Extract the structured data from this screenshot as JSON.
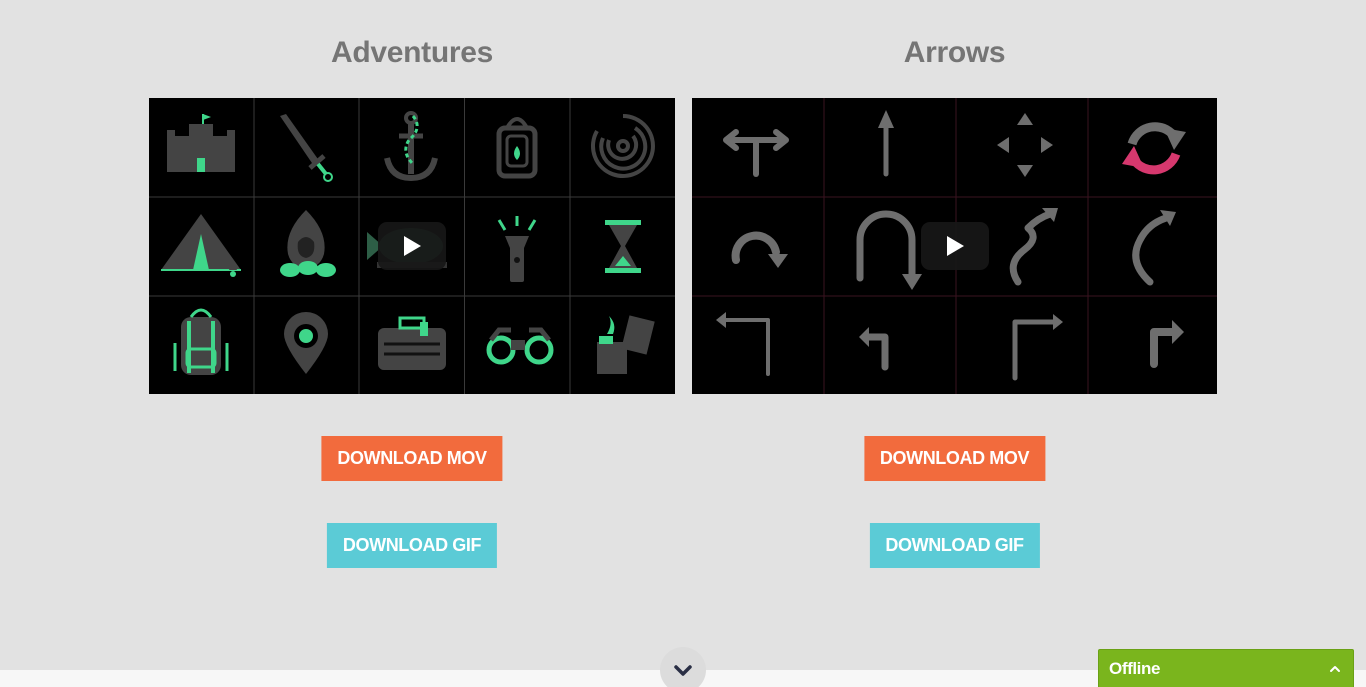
{
  "colors": {
    "background": "#e2e2e2",
    "mov_button": "#f26b3d",
    "gif_button": "#5bcbd6",
    "chat_bar": "#7ab51d",
    "icon_gray": "#444444",
    "icon_green": "#3fd68a",
    "arrow_gray": "#6e6e6e",
    "arrow_pink": "#d6386e"
  },
  "sections": [
    {
      "title": "Adventures",
      "icons": [
        "castle-icon",
        "sword-icon",
        "anchor-icon",
        "lantern-icon",
        "maze-icon",
        "tent-icon",
        "campfire-icon",
        "fish-icon",
        "flashlight-icon",
        "hourglass-icon",
        "backpack-icon",
        "map-pin-icon",
        "suitcase-icon",
        "binoculars-icon",
        "lighter-icon"
      ],
      "mov_label": "DOWNLOAD MOV",
      "gif_label": "DOWNLOAD GIF"
    },
    {
      "title": "Arrows",
      "icons": [
        "split-arrow-icon",
        "up-arrow-icon",
        "four-way-arrows-icon",
        "refresh-arrows-icon",
        "curved-right-arrow-icon",
        "u-turn-arrow-icon",
        "s-curve-arrow-icon",
        "curved-up-arrow-icon",
        "corner-left-arrow-icon",
        "turn-left-arrow-icon",
        "corner-right-arrow-icon",
        "turn-right-arrow-icon"
      ],
      "mov_label": "DOWNLOAD MOV",
      "gif_label": "DOWNLOAD GIF"
    }
  ],
  "chat": {
    "status": "Offline"
  }
}
